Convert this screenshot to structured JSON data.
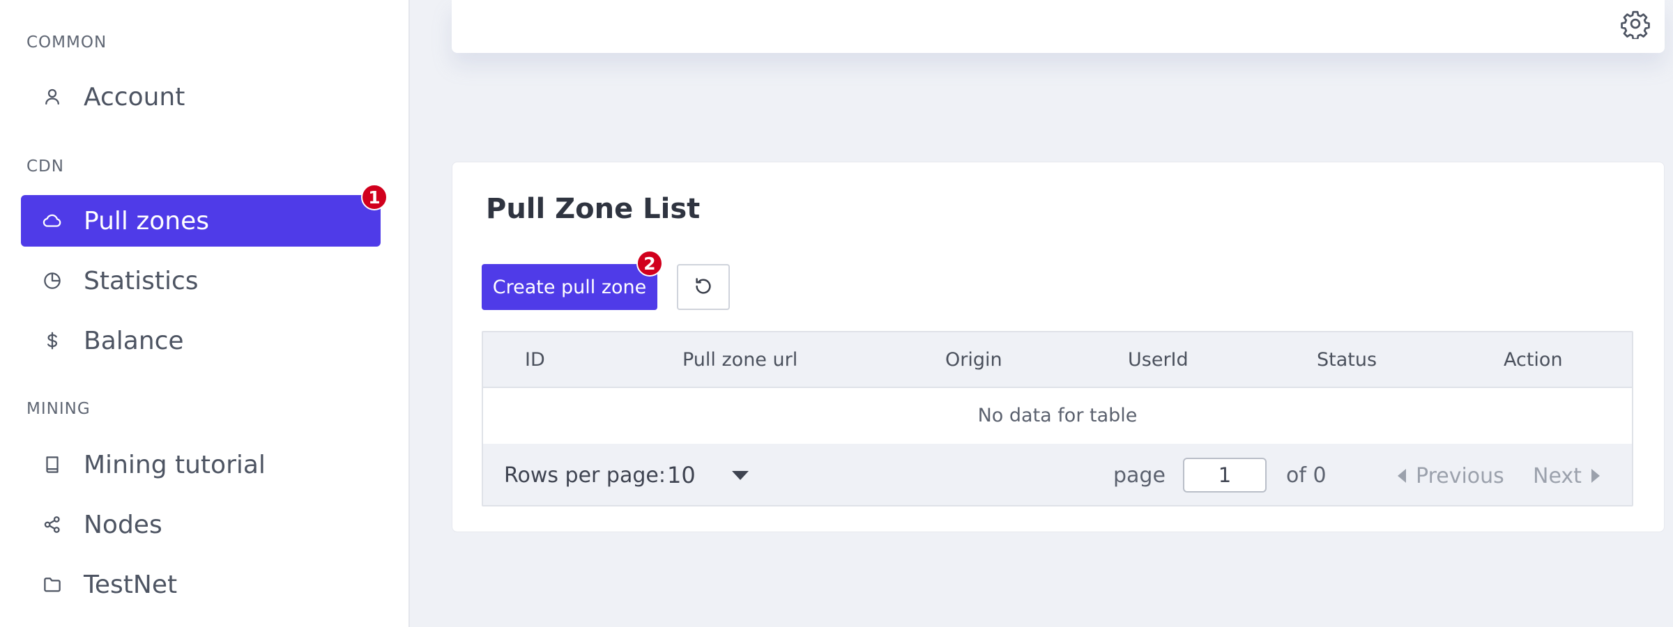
{
  "sidebar": {
    "sections": [
      {
        "title": "COMMON",
        "items": [
          {
            "label": "Account",
            "icon": "user-icon"
          }
        ]
      },
      {
        "title": "CDN",
        "items": [
          {
            "label": "Pull zones",
            "icon": "cloud-icon",
            "active": true,
            "badge": "1"
          },
          {
            "label": "Statistics",
            "icon": "pie-chart-icon"
          },
          {
            "label": "Balance",
            "icon": "dollar-icon"
          }
        ]
      },
      {
        "title": "MINING",
        "items": [
          {
            "label": "Mining tutorial",
            "icon": "book-icon"
          },
          {
            "label": "Nodes",
            "icon": "share-nodes-icon"
          },
          {
            "label": "TestNet",
            "icon": "folder-icon"
          }
        ]
      }
    ]
  },
  "header": {
    "settings_icon": "gear-icon"
  },
  "main": {
    "title": "Pull Zone List",
    "create_button": {
      "label": "Create pull zone",
      "badge": "2"
    },
    "refresh_icon": "refresh-icon",
    "table": {
      "columns": [
        "ID",
        "Pull zone url",
        "Origin",
        "UserId",
        "Status",
        "Action"
      ],
      "rows": [],
      "empty_text": "No data for table"
    },
    "pagination": {
      "rows_per_page_label": "Rows per page:",
      "rows_per_page_value": "10",
      "page_label": "page",
      "page_value": "1",
      "of_label": "of 0",
      "previous_label": "Previous",
      "next_label": "Next"
    }
  },
  "colors": {
    "accent": "#4f3be8",
    "badge": "#d1001d",
    "background": "#eff1f6"
  }
}
